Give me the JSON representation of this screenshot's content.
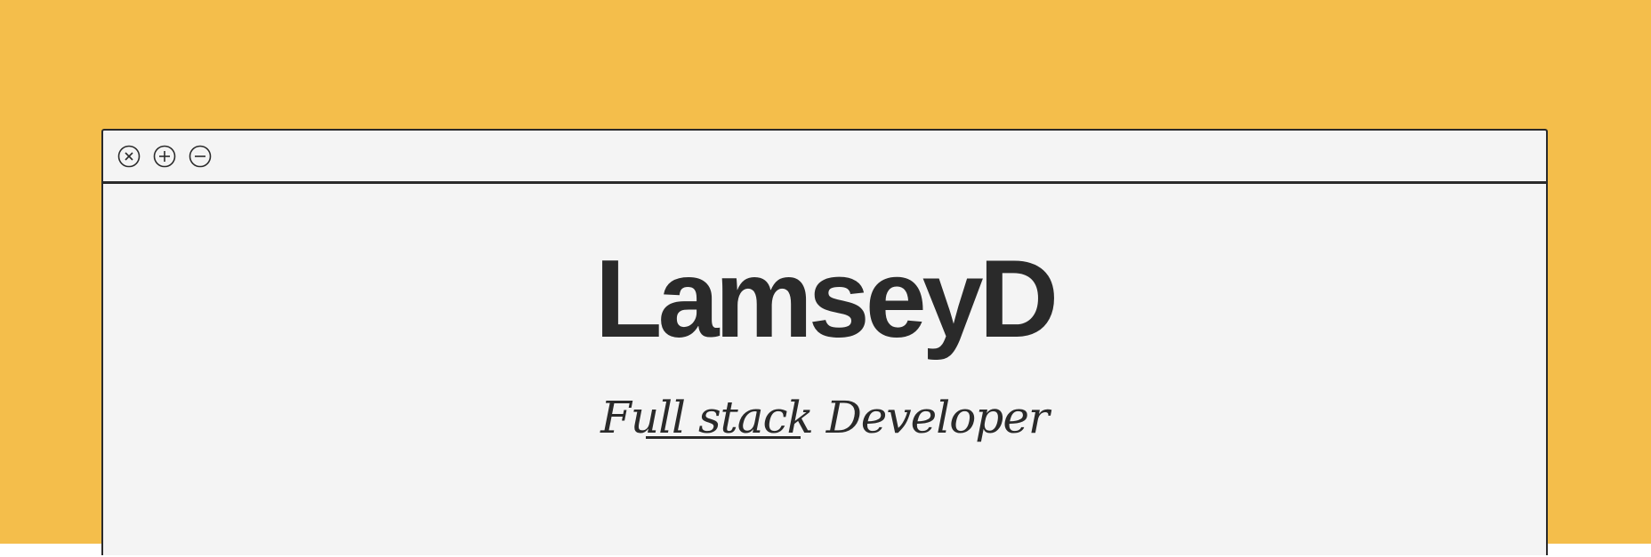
{
  "theme": {
    "background": "#F4BE4B",
    "window_background": "#F4F4F4",
    "ink": "#2A2A2A"
  },
  "window": {
    "controls": [
      {
        "name": "close",
        "icon": "close-circle-icon"
      },
      {
        "name": "maximize",
        "icon": "plus-circle-icon"
      },
      {
        "name": "minimize",
        "icon": "minus-circle-icon"
      }
    ]
  },
  "hero": {
    "name": "LamseyD",
    "role": "Full stack Developer"
  }
}
